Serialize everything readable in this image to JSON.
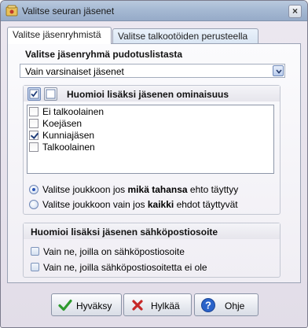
{
  "window": {
    "title": "Valitse seuran jäsenet",
    "close_symbol": "×"
  },
  "tabs": [
    {
      "label": "Valitse jäsenryhmistä",
      "active": true
    },
    {
      "label": "Valitse talkootöiden perusteella",
      "active": false
    }
  ],
  "member_group": {
    "heading": "Valitse jäsenryhmä pudotuslistasta",
    "selected": "Vain varsinaiset jäsenet"
  },
  "properties": {
    "heading": "Huomioi lisäksi jäsenen ominaisuus",
    "items": [
      {
        "label": "Ei talkoolainen",
        "checked": false
      },
      {
        "label": "Koejäsen",
        "checked": false
      },
      {
        "label": "Kunniajäsen",
        "checked": true
      },
      {
        "label": "Talkoolainen",
        "checked": false
      }
    ],
    "radio_any": {
      "before": "Valitse joukkoon jos ",
      "bold": "mikä tahansa",
      "after": " ehto täyttyy",
      "checked": true
    },
    "radio_all": {
      "before": "Valitse joukkoon vain jos ",
      "bold": "kaikki",
      "after": " ehdot täyttyvät",
      "checked": false
    }
  },
  "email": {
    "heading": "Huomioi lisäksi jäsenen sähköpostiosoite",
    "option1": "Vain ne, joilla on sähköpostiosoite",
    "option2": "Vain ne, joilla sähköpostiosoitetta ei ole"
  },
  "buttons": {
    "ok": "Hyväksy",
    "cancel": "Hylkää",
    "help": "Ohje"
  },
  "colors": {
    "ok_green": "#2e9a2e",
    "cancel_red": "#c62828",
    "help_blue": "#2a63c9"
  }
}
